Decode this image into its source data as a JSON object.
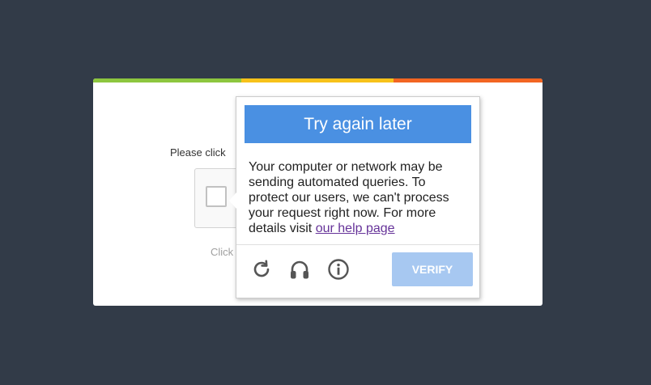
{
  "card": {
    "prompt_text": "Please click",
    "hint_text": "Click"
  },
  "popup": {
    "banner_title": "Try again later",
    "message": "Your computer or network may be sending automated queries. To protect our users, we can't process your request right now. For more details visit ",
    "help_link": "our help page",
    "verify_label": "VERIFY",
    "icons": [
      "reload-icon",
      "headphones-icon",
      "info-icon"
    ]
  },
  "colors": {
    "background": "#323b48",
    "banner": "#4a90e2",
    "verify_disabled": "#a7c8f1",
    "stripe_green": "#8dc63f",
    "stripe_yellow": "#f7c21a",
    "stripe_orange": "#f26522",
    "link": "#663399"
  }
}
